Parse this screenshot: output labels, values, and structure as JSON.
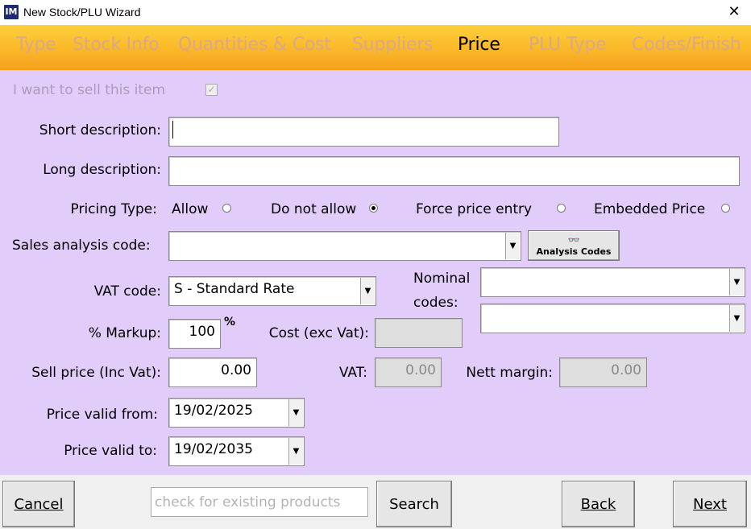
{
  "window": {
    "icon_text": "IM",
    "title": "New Stock/PLU Wizard"
  },
  "tabs": [
    {
      "label": "Type",
      "active": false
    },
    {
      "label": "Stock Info",
      "active": false
    },
    {
      "label": "Quantities & Cost",
      "active": false
    },
    {
      "label": "Suppliers",
      "active": false
    },
    {
      "label": "Price",
      "active": true
    },
    {
      "label": "PLU Type",
      "active": false
    },
    {
      "label": "Codes/Finish",
      "active": false
    }
  ],
  "form": {
    "sell_item_label": "I want to sell this item",
    "sell_item_checked": true,
    "short_desc_label": "Short description:",
    "short_desc_value": "",
    "long_desc_label": "Long description:",
    "long_desc_value": "",
    "pricing_type_label": "Pricing Type:",
    "pricing_options": [
      {
        "label": "Allow",
        "selected": false
      },
      {
        "label": "Do not allow",
        "selected": true
      },
      {
        "label": "Force price entry",
        "selected": false
      },
      {
        "label": "Embedded Price",
        "selected": false
      }
    ],
    "sales_analysis_label": "Sales analysis code:",
    "sales_analysis_value": "",
    "analysis_codes_button": "Analysis Codes",
    "vat_code_label": "VAT code:",
    "vat_code_value": "S - Standard Rate",
    "nominal_codes_label_1": "Nominal",
    "nominal_codes_label_2": "codes:",
    "nominal_code_1": "",
    "nominal_code_2": "",
    "markup_label": "% Markup:",
    "markup_value": "100",
    "markup_unit": "%",
    "cost_label": "Cost (exc Vat):",
    "cost_value": "",
    "sell_price_label": "Sell price (Inc Vat):",
    "sell_price_value": "0.00",
    "vat_label": "VAT:",
    "vat_value": "0.00",
    "nett_margin_label": "Nett margin:",
    "nett_margin_value": "0.00",
    "valid_from_label": "Price valid from:",
    "valid_from_value": "19/02/2025",
    "valid_to_label": "Price valid to:",
    "valid_to_value": "19/02/2035"
  },
  "bottom": {
    "cancel_label": "Cancel",
    "search_placeholder": "check for existing products",
    "search_label": "Search",
    "back_label": "Back",
    "next_label": "Next"
  },
  "colors": {
    "content_bg": "#e2ccfa",
    "tab_active": "#000000",
    "tab_inactive": "#d8a88b"
  }
}
